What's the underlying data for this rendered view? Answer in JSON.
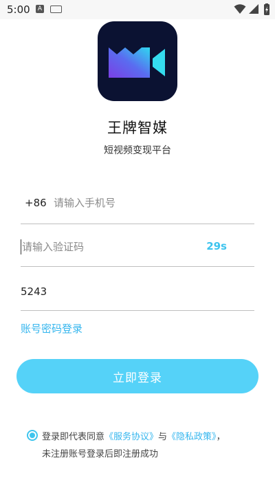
{
  "status_bar": {
    "time": "5:00",
    "notification_icon": "A",
    "icons": [
      "notification-a-icon",
      "keyboard-icon",
      "wifi-icon",
      "signal-icon",
      "battery-charging-icon"
    ]
  },
  "app": {
    "logo_icon": "video-camera-logo",
    "name": "王牌智媒",
    "slogan": "短视频变现平台"
  },
  "form": {
    "country_code": "+86",
    "phone_placeholder": "请输入手机号",
    "phone_value": "",
    "code_placeholder": "请输入验证码",
    "code_value": "",
    "countdown": "29s",
    "invite_value": "5243"
  },
  "alt_login_label": "账号密码登录",
  "login_button_label": "立即登录",
  "agreement": {
    "checked": true,
    "prefix": "登录即代表同意",
    "service_link": "《服务协议》",
    "conjunction": "与",
    "privacy_link": "《隐私政策》",
    "comma": "，",
    "second_line": "未注册账号登录后即注册成功"
  },
  "colors": {
    "accent": "#35b6ee",
    "button": "#55d2f8",
    "logo_bg": "#0b1232"
  }
}
